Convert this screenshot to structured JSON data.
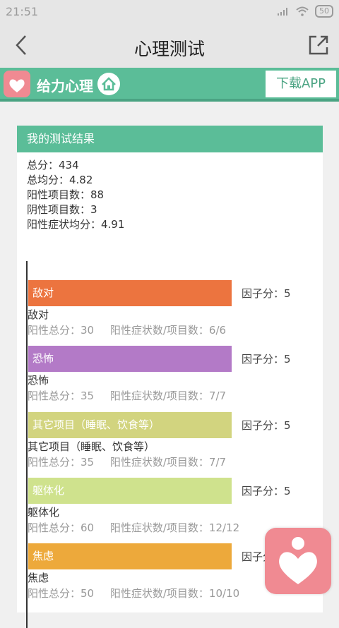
{
  "statusbar": {
    "time": "21:51",
    "battery": "50"
  },
  "titlebar": {
    "title": "心理测试"
  },
  "banner": {
    "brand": "给力心理",
    "download": "下载APP"
  },
  "card": {
    "header": "我的测试结果",
    "summary": [
      "总分：434",
      "总均分：4.82",
      "阳性项目数：88",
      "阴性项目数：3",
      "阳性症状均分：4.91"
    ]
  },
  "factors": [
    {
      "label": "敌对",
      "score": "因子分：5",
      "name": "敌对",
      "total": "阳性总分：30",
      "ratio": "阳性症状数/项目数：6/6",
      "color": "#ec743f"
    },
    {
      "label": "恐怖",
      "score": "因子分：5",
      "name": "恐怖",
      "total": "阳性总分：35",
      "ratio": "阳性症状数/项目数：7/7",
      "color": "#b37ac7"
    },
    {
      "label": "其它项目（睡眠、饮食等）",
      "score": "因子分：5",
      "name": "其它项目（睡眠、饮食等）",
      "total": "阳性总分：35",
      "ratio": "阳性症状数/项目数：7/7",
      "color": "#d2d47f"
    },
    {
      "label": "躯体化",
      "score": "因子分：5",
      "name": "躯体化",
      "total": "阳性总分：60",
      "ratio": "阳性症状数/项目数：12/12",
      "color": "#cfe28d"
    },
    {
      "label": "焦虑",
      "score": "因子分",
      "name": "焦虑",
      "total": "阳性总分：50",
      "ratio": "阳性症状数/项目数：10/10",
      "color": "#eda93b"
    }
  ]
}
